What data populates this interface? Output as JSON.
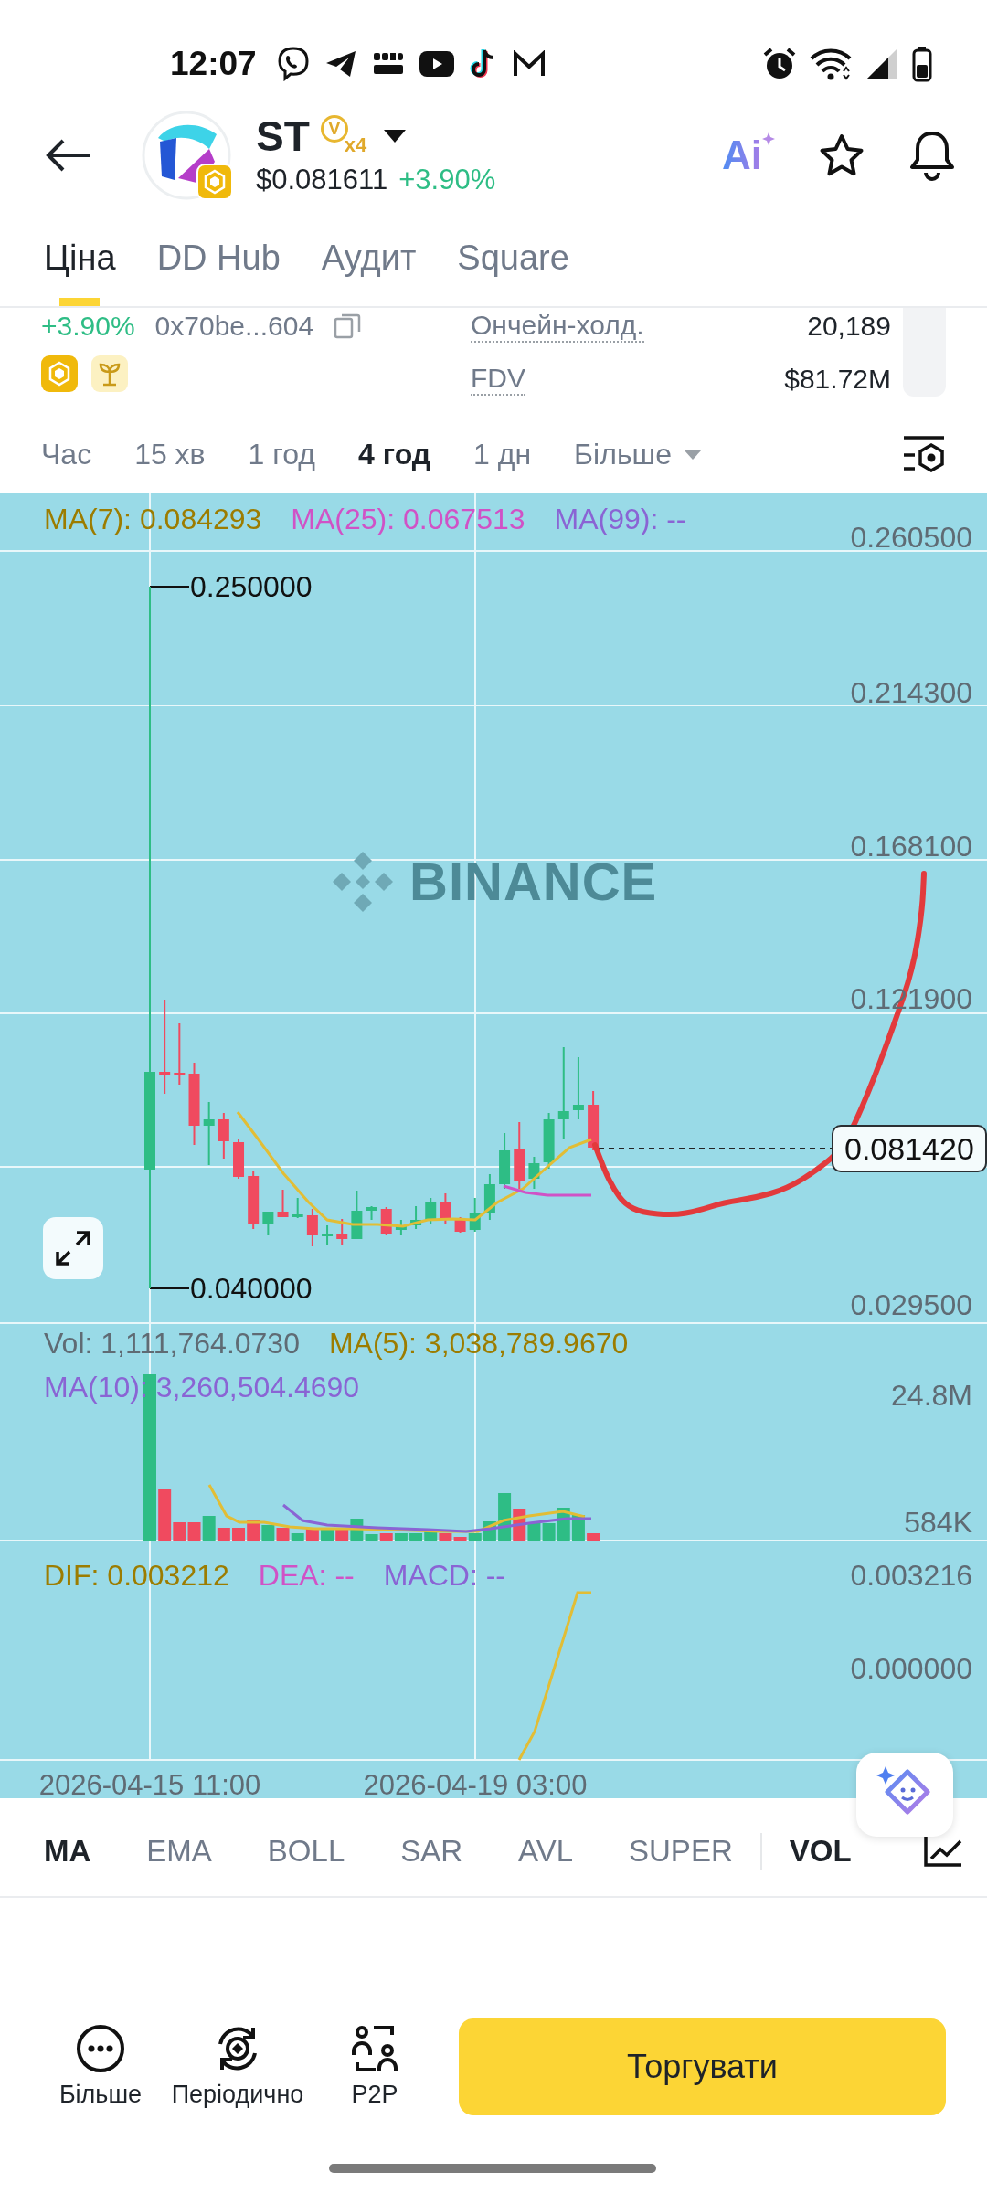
{
  "status_bar": {
    "time": "12:07"
  },
  "header": {
    "symbol": "ST",
    "badge_letter": "V",
    "badge_multiplier": "x4",
    "price": "$0.081611",
    "change": "+3.90%",
    "ai_label": "Ai"
  },
  "tabs": [
    {
      "label": "Ціна",
      "selected": true
    },
    {
      "label": "DD Hub",
      "selected": false
    },
    {
      "label": "Аудит",
      "selected": false
    },
    {
      "label": "Square",
      "selected": false
    }
  ],
  "overview": {
    "change": "+3.90%",
    "contract": "0x70be...604",
    "stats": [
      {
        "label": "Ончейн-холд.",
        "value": "20,189"
      },
      {
        "label": "FDV",
        "value": "$81.72M"
      }
    ]
  },
  "intervals": [
    {
      "label": "Час",
      "selected": false,
      "kind": "option"
    },
    {
      "label": "15 хв",
      "selected": false,
      "kind": "option"
    },
    {
      "label": "1 год",
      "selected": false,
      "kind": "option"
    },
    {
      "label": "4 год",
      "selected": true,
      "kind": "option"
    },
    {
      "label": "1 дн",
      "selected": false,
      "kind": "option"
    },
    {
      "label": "Більше",
      "selected": false,
      "kind": "menu"
    }
  ],
  "chart": {
    "legend": [
      {
        "label": "MA(7): 0.084293",
        "color": "#9c7c00"
      },
      {
        "label": "MA(25): 0.067513",
        "color": "#d052c6"
      },
      {
        "label": "MA(99): --",
        "color": "#8a64d4"
      }
    ],
    "price_ticks": [
      "0.260500",
      "0.214300",
      "0.168100",
      "0.121900",
      "0.029500"
    ],
    "high_label": "0.250000",
    "low_label": "0.040000",
    "last_price": "0.081420",
    "watermark": "BINANCE"
  },
  "volume": {
    "legend": [
      {
        "label": "Vol: 1,111,764.0730",
        "color": "#5f6b74"
      },
      {
        "label": "MA(5): 3,038,789.9670",
        "color": "#9c7c00"
      },
      {
        "label": "MA(10): 3,260,504.4690",
        "color": "#8a64d4"
      }
    ],
    "ticks": [
      "24.8M",
      "584K"
    ]
  },
  "macd": {
    "legend": [
      {
        "label": "DIF: 0.003212",
        "color": "#9c7c00"
      },
      {
        "label": "DEA: --",
        "color": "#d052c6"
      },
      {
        "label": "MACD: --",
        "color": "#8a64d4"
      }
    ],
    "ticks": [
      "0.003216",
      "0.000000"
    ]
  },
  "time_axis": [
    "2026-04-15 11:00",
    "2026-04-19 03:00"
  ],
  "main_indicators": [
    {
      "label": "MA",
      "selected": true
    },
    {
      "label": "EMA",
      "selected": false
    },
    {
      "label": "BOLL",
      "selected": false
    },
    {
      "label": "SAR",
      "selected": false
    },
    {
      "label": "AVL",
      "selected": false
    },
    {
      "label": "SUPER",
      "selected": false
    }
  ],
  "sub_indicators": [
    {
      "label": "VOL",
      "selected": true
    }
  ],
  "bottom_bar": {
    "actions": [
      {
        "label": "Більше",
        "kind": "more"
      },
      {
        "label": "Періодично",
        "kind": "recurring"
      },
      {
        "label": "P2P",
        "kind": "p2p"
      }
    ],
    "trade_button": "Торгувати"
  }
}
